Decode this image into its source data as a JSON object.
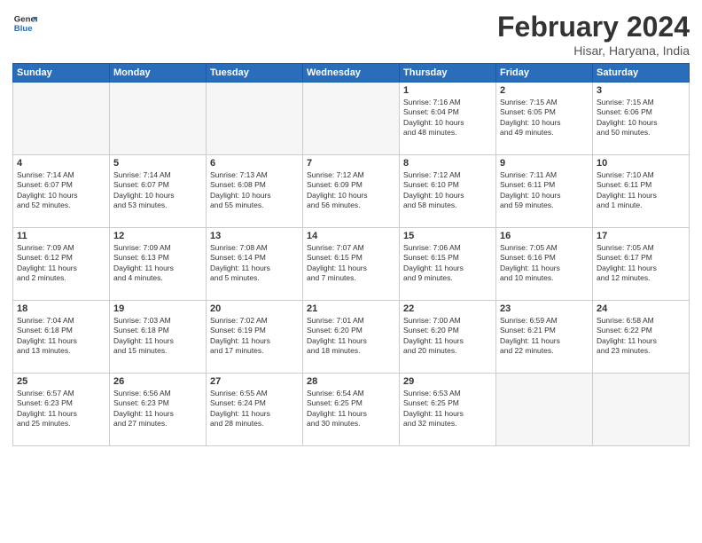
{
  "logo": {
    "general": "General",
    "blue": "Blue"
  },
  "title": "February 2024",
  "location": "Hisar, Haryana, India",
  "days_header": [
    "Sunday",
    "Monday",
    "Tuesday",
    "Wednesday",
    "Thursday",
    "Friday",
    "Saturday"
  ],
  "weeks": [
    [
      {
        "day": "",
        "info": ""
      },
      {
        "day": "",
        "info": ""
      },
      {
        "day": "",
        "info": ""
      },
      {
        "day": "",
        "info": ""
      },
      {
        "day": "1",
        "info": "Sunrise: 7:16 AM\nSunset: 6:04 PM\nDaylight: 10 hours\nand 48 minutes."
      },
      {
        "day": "2",
        "info": "Sunrise: 7:15 AM\nSunset: 6:05 PM\nDaylight: 10 hours\nand 49 minutes."
      },
      {
        "day": "3",
        "info": "Sunrise: 7:15 AM\nSunset: 6:06 PM\nDaylight: 10 hours\nand 50 minutes."
      }
    ],
    [
      {
        "day": "4",
        "info": "Sunrise: 7:14 AM\nSunset: 6:07 PM\nDaylight: 10 hours\nand 52 minutes."
      },
      {
        "day": "5",
        "info": "Sunrise: 7:14 AM\nSunset: 6:07 PM\nDaylight: 10 hours\nand 53 minutes."
      },
      {
        "day": "6",
        "info": "Sunrise: 7:13 AM\nSunset: 6:08 PM\nDaylight: 10 hours\nand 55 minutes."
      },
      {
        "day": "7",
        "info": "Sunrise: 7:12 AM\nSunset: 6:09 PM\nDaylight: 10 hours\nand 56 minutes."
      },
      {
        "day": "8",
        "info": "Sunrise: 7:12 AM\nSunset: 6:10 PM\nDaylight: 10 hours\nand 58 minutes."
      },
      {
        "day": "9",
        "info": "Sunrise: 7:11 AM\nSunset: 6:11 PM\nDaylight: 10 hours\nand 59 minutes."
      },
      {
        "day": "10",
        "info": "Sunrise: 7:10 AM\nSunset: 6:11 PM\nDaylight: 11 hours\nand 1 minute."
      }
    ],
    [
      {
        "day": "11",
        "info": "Sunrise: 7:09 AM\nSunset: 6:12 PM\nDaylight: 11 hours\nand 2 minutes."
      },
      {
        "day": "12",
        "info": "Sunrise: 7:09 AM\nSunset: 6:13 PM\nDaylight: 11 hours\nand 4 minutes."
      },
      {
        "day": "13",
        "info": "Sunrise: 7:08 AM\nSunset: 6:14 PM\nDaylight: 11 hours\nand 5 minutes."
      },
      {
        "day": "14",
        "info": "Sunrise: 7:07 AM\nSunset: 6:15 PM\nDaylight: 11 hours\nand 7 minutes."
      },
      {
        "day": "15",
        "info": "Sunrise: 7:06 AM\nSunset: 6:15 PM\nDaylight: 11 hours\nand 9 minutes."
      },
      {
        "day": "16",
        "info": "Sunrise: 7:05 AM\nSunset: 6:16 PM\nDaylight: 11 hours\nand 10 minutes."
      },
      {
        "day": "17",
        "info": "Sunrise: 7:05 AM\nSunset: 6:17 PM\nDaylight: 11 hours\nand 12 minutes."
      }
    ],
    [
      {
        "day": "18",
        "info": "Sunrise: 7:04 AM\nSunset: 6:18 PM\nDaylight: 11 hours\nand 13 minutes."
      },
      {
        "day": "19",
        "info": "Sunrise: 7:03 AM\nSunset: 6:18 PM\nDaylight: 11 hours\nand 15 minutes."
      },
      {
        "day": "20",
        "info": "Sunrise: 7:02 AM\nSunset: 6:19 PM\nDaylight: 11 hours\nand 17 minutes."
      },
      {
        "day": "21",
        "info": "Sunrise: 7:01 AM\nSunset: 6:20 PM\nDaylight: 11 hours\nand 18 minutes."
      },
      {
        "day": "22",
        "info": "Sunrise: 7:00 AM\nSunset: 6:20 PM\nDaylight: 11 hours\nand 20 minutes."
      },
      {
        "day": "23",
        "info": "Sunrise: 6:59 AM\nSunset: 6:21 PM\nDaylight: 11 hours\nand 22 minutes."
      },
      {
        "day": "24",
        "info": "Sunrise: 6:58 AM\nSunset: 6:22 PM\nDaylight: 11 hours\nand 23 minutes."
      }
    ],
    [
      {
        "day": "25",
        "info": "Sunrise: 6:57 AM\nSunset: 6:23 PM\nDaylight: 11 hours\nand 25 minutes."
      },
      {
        "day": "26",
        "info": "Sunrise: 6:56 AM\nSunset: 6:23 PM\nDaylight: 11 hours\nand 27 minutes."
      },
      {
        "day": "27",
        "info": "Sunrise: 6:55 AM\nSunset: 6:24 PM\nDaylight: 11 hours\nand 28 minutes."
      },
      {
        "day": "28",
        "info": "Sunrise: 6:54 AM\nSunset: 6:25 PM\nDaylight: 11 hours\nand 30 minutes."
      },
      {
        "day": "29",
        "info": "Sunrise: 6:53 AM\nSunset: 6:25 PM\nDaylight: 11 hours\nand 32 minutes."
      },
      {
        "day": "",
        "info": ""
      },
      {
        "day": "",
        "info": ""
      }
    ]
  ]
}
